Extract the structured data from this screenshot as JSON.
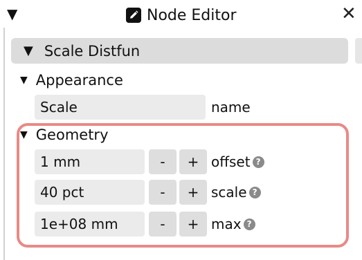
{
  "window": {
    "collapse_icon": "▼",
    "title": "Node Editor",
    "close_icon": "✕"
  },
  "node": {
    "expand_icon": "▼",
    "title": "Scale Distfun"
  },
  "appearance": {
    "expand_icon": "▼",
    "title": "Appearance",
    "name_value": "Scale",
    "name_label": "name"
  },
  "geometry": {
    "expand_icon": "▼",
    "title": "Geometry",
    "fields": [
      {
        "value": "1 mm",
        "label": "offset",
        "minus": "-",
        "plus": "+"
      },
      {
        "value": "40 pct",
        "label": "scale",
        "minus": "-",
        "plus": "+"
      },
      {
        "value": "1e+08 mm",
        "label": "max",
        "minus": "-",
        "plus": "+"
      }
    ],
    "help_icon": "?"
  },
  "colors": {
    "highlight_border": "#e88a86",
    "header_bg": "#dcdcdc",
    "field_bg": "#ebebeb",
    "button_bg": "#dedede"
  }
}
